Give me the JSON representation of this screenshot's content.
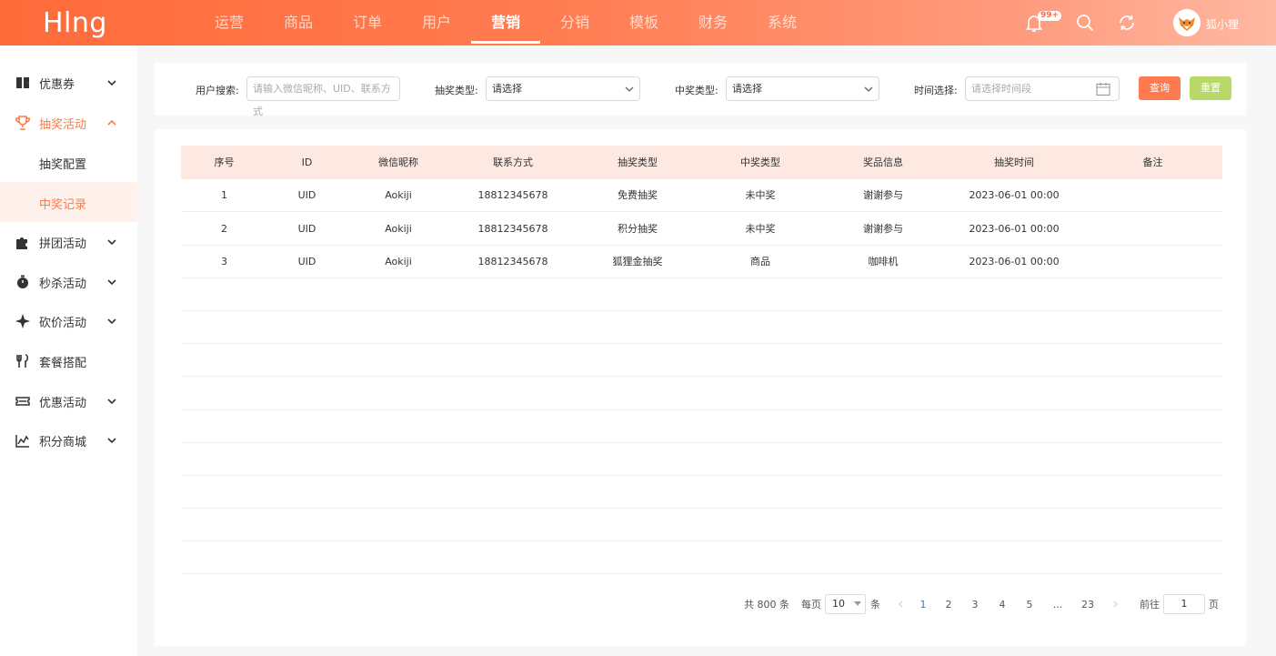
{
  "header": {
    "logo": "Hlng",
    "nav": [
      "运营",
      "商品",
      "订单",
      "用户",
      "营销",
      "分销",
      "模板",
      "财务",
      "系统"
    ],
    "active_nav": "营销",
    "badge": "99+",
    "username": "狐小狸",
    "accent_color": "#ff6a3a"
  },
  "sidebar": {
    "items": [
      {
        "label": "优惠券",
        "icon": "coupon-icon"
      },
      {
        "label": "抽奖活动",
        "icon": "trophy-icon"
      },
      {
        "label": "拼团活动",
        "icon": "puzzle-icon"
      },
      {
        "label": "秒杀活动",
        "icon": "stopwatch-icon"
      },
      {
        "label": "砍价活动",
        "icon": "sparkle-icon"
      },
      {
        "label": "套餐搭配",
        "icon": "cutlery-icon"
      },
      {
        "label": "优惠活动",
        "icon": "ticket-icon"
      },
      {
        "label": "积分商城",
        "icon": "chart-icon"
      }
    ],
    "sub_items": [
      "抽奖配置",
      "中奖记录"
    ],
    "active_sub": "中奖记录"
  },
  "filters": {
    "user_search_label": "用户搜索:",
    "user_search_placeholder": "请输入微信昵称、UID、联系方式",
    "lottery_type_label": "抽奖类型:",
    "lottery_type_value": "请选择",
    "prize_type_label": "中奖类型:",
    "prize_type_value": "请选择",
    "time_label": "时间选择:",
    "time_placeholder": "请选择时间段",
    "query_button": "查询",
    "reset_button": "重置",
    "query_color": "#ff7a4f",
    "reset_color": "#b8d86a"
  },
  "table": {
    "columns": [
      "序号",
      "ID",
      "微信昵称",
      "联系方式",
      "抽奖类型",
      "中奖类型",
      "奖品信息",
      "抽奖时间",
      "备注"
    ],
    "rows": [
      [
        "1",
        "UID",
        "Aokiji",
        "18812345678",
        "免费抽奖",
        "未中奖",
        "谢谢参与",
        "2023-06-01 00:00",
        ""
      ],
      [
        "2",
        "UID",
        "Aokiji",
        "18812345678",
        "积分抽奖",
        "未中奖",
        "谢谢参与",
        "2023-06-01 00:00",
        ""
      ],
      [
        "3",
        "UID",
        "Aokiji",
        "18812345678",
        "狐狸金抽奖",
        "商品",
        "咖啡机",
        "2023-06-01 00:00",
        ""
      ]
    ]
  },
  "pagination": {
    "total": "共 800 条",
    "per_page_label": "每页",
    "per_page_value": "10",
    "per_page_unit": "条",
    "pages": [
      "1",
      "2",
      "3",
      "4",
      "5",
      "...",
      "23"
    ],
    "current_page": "1",
    "goto_label": "前往",
    "goto_value": "1",
    "goto_unit": "页"
  }
}
